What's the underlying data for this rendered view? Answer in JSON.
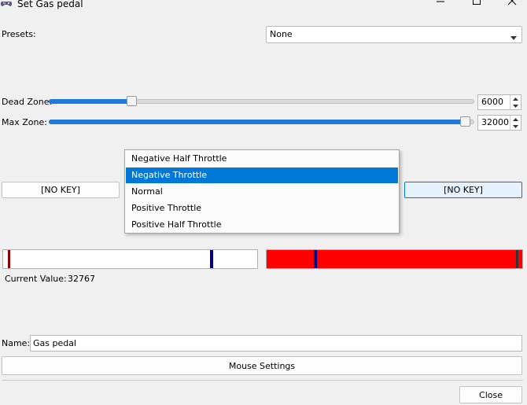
{
  "window": {
    "title": "Set Gas pedal",
    "icons": {
      "app": "gamepad-icon",
      "minimize": "minimize-icon",
      "maximize": "maximize-icon",
      "close": "close-icon"
    }
  },
  "presets": {
    "label": "Presets:",
    "value": "None"
  },
  "dead_zone": {
    "label": "Dead Zone:",
    "value": "6000",
    "slider_fraction": 0.1875
  },
  "max_zone": {
    "label": "Max Zone:",
    "value": "32000",
    "slider_fraction": 1.0
  },
  "left_key_button": "[NO KEY]",
  "right_key_button": "[NO KEY]",
  "throttle_menu": {
    "items": [
      "Negative Half Throttle",
      "Negative Throttle",
      "Normal",
      "Positive Throttle",
      "Positive Half Throttle"
    ],
    "selected": "Negative Throttle"
  },
  "axis": {
    "current_value_label": "Current Value:",
    "current_value": "32767",
    "left_bar_color": "#ffffff",
    "right_bar_color": "#ff0000"
  },
  "name": {
    "label": "Name:",
    "value": "Gas pedal"
  },
  "mouse_settings_button": "Mouse Settings",
  "close_button": "Close",
  "colors": {
    "accent": "#0078d7",
    "slider_fill": "#1f7ad8",
    "dead_zone_marker": "#8b0000",
    "max_zone_marker": "#00008b"
  }
}
